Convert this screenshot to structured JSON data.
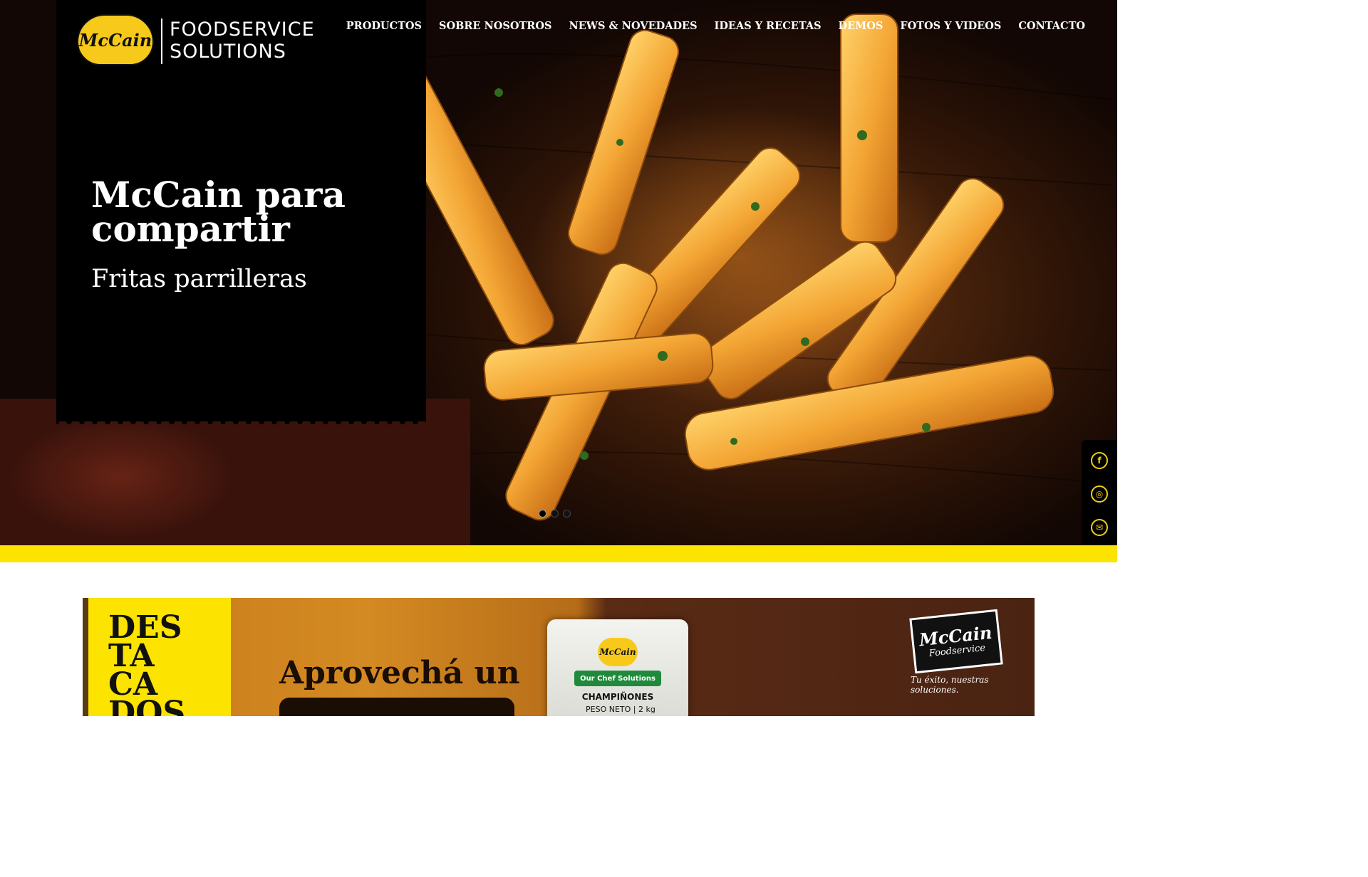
{
  "brand": {
    "logo_text": "McCain",
    "wordmark_line1": "FOODSERVICE",
    "wordmark_line2": "SOLUTIONS",
    "accent": "#fce300",
    "logo_yellow": "#f7c91b"
  },
  "nav": {
    "items": [
      "PRODUCTOS",
      "SOBRE NOSOTROS",
      "NEWS & NOVEDADES",
      "IDEAS Y RECETAS",
      "DEMOS",
      "FOTOS Y VIDEOS",
      "CONTACTO"
    ]
  },
  "hero": {
    "title": "McCain para compartir",
    "subtitle": "Fritas parrilleras",
    "slide_count": 3,
    "active_slide": 1
  },
  "social": {
    "items": [
      {
        "icon": "facebook-icon",
        "glyph": "f"
      },
      {
        "icon": "instagram-icon",
        "glyph": "◎"
      },
      {
        "icon": "email-icon",
        "glyph": "✉"
      }
    ]
  },
  "featured": {
    "label": "DES TA CA DOS",
    "promo_text": "Aprovechá un",
    "package": {
      "logo": "McCain",
      "line": "Our Chef Solutions",
      "product": "CHAMPIÑONES",
      "weight": "PESO NETO | 2 kg"
    },
    "foodservice_logo": "McCain",
    "foodservice_sub": "Foodservice",
    "tagline": "Tu éxito, nuestras soluciones."
  }
}
